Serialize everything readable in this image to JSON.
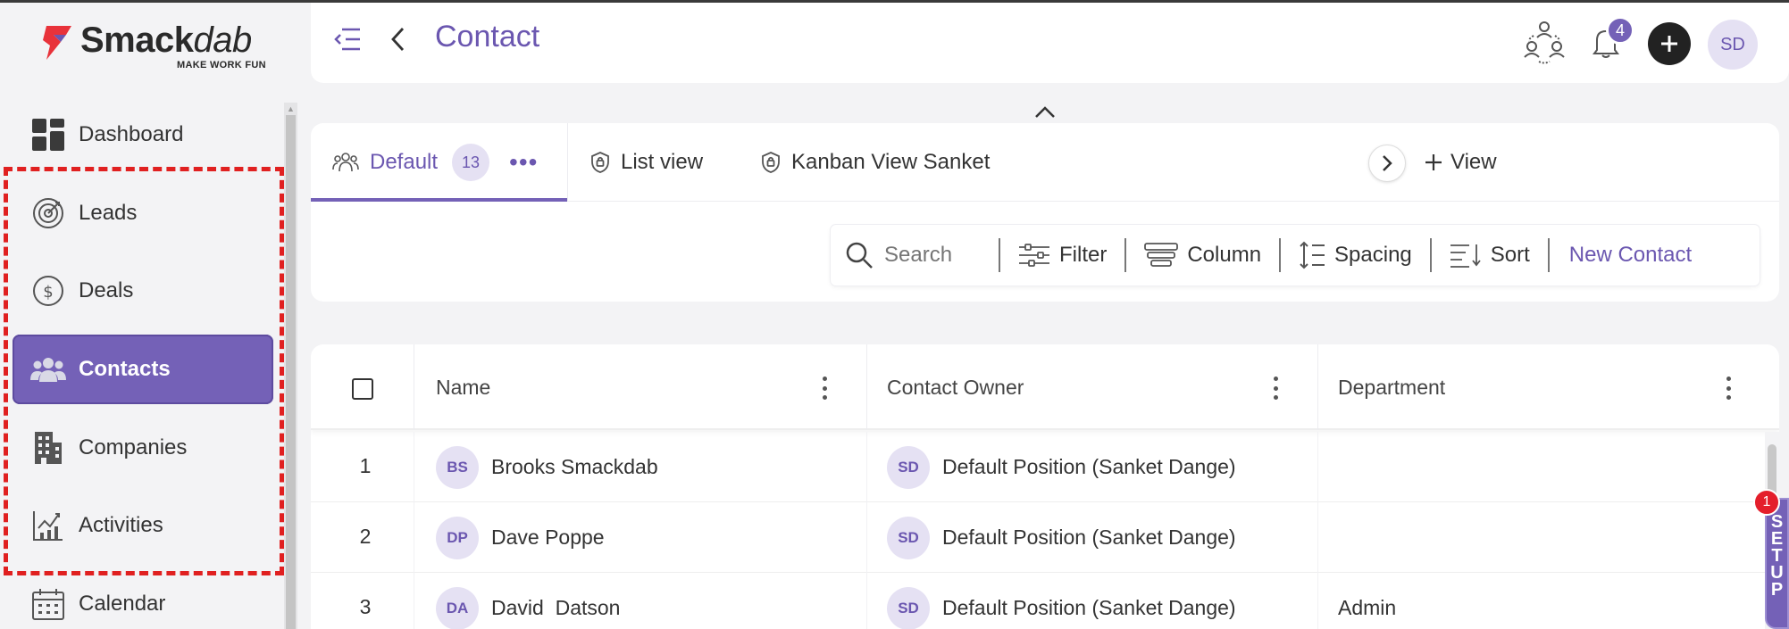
{
  "app": {
    "logo_name_bold": "Smack",
    "logo_name_italic": "dab",
    "logo_tagline": "MAKE WORK FUN",
    "brand_color": "#7461b7",
    "logo_mark_color": "#e8323a"
  },
  "sidebar": {
    "items": [
      {
        "label": "Dashboard",
        "icon": "dashboard-grid-icon",
        "active": false
      },
      {
        "label": "Leads",
        "icon": "target-icon",
        "active": false
      },
      {
        "label": "Deals",
        "icon": "dollar-coin-icon",
        "active": false
      },
      {
        "label": "Contacts",
        "icon": "people-group-icon",
        "active": true
      },
      {
        "label": "Companies",
        "icon": "building-icon",
        "active": false
      },
      {
        "label": "Activities",
        "icon": "activity-chart-icon",
        "active": false
      },
      {
        "label": "Calendar",
        "icon": "calendar-icon",
        "active": false
      }
    ],
    "highlight_color": "#e02020"
  },
  "header": {
    "title": "Contact",
    "notification_count": "4",
    "user_initials": "SD"
  },
  "views": {
    "tabs": [
      {
        "label": "Default",
        "count": "13",
        "active": true,
        "icon": "users-icon"
      },
      {
        "label": "List view",
        "active": false,
        "icon": "shield-lock-icon"
      },
      {
        "label": "Kanban View Sanket",
        "active": false,
        "icon": "shield-lock-icon"
      }
    ],
    "add_view_label": "View"
  },
  "toolbar": {
    "search_placeholder": "Search",
    "filter_label": "Filter",
    "column_label": "Column",
    "spacing_label": "Spacing",
    "sort_label": "Sort",
    "new_contact_label": "New Contact"
  },
  "table": {
    "columns": [
      "Name",
      "Contact Owner",
      "Department"
    ],
    "rows": [
      {
        "num": "1",
        "initials": "BS",
        "name": "Brooks Smackdab",
        "owner_initials": "SD",
        "owner": "Default Position (Sanket Dange)",
        "department": ""
      },
      {
        "num": "2",
        "initials": "DP",
        "name": "Dave Poppe",
        "owner_initials": "SD",
        "owner": "Default Position (Sanket Dange)",
        "department": ""
      },
      {
        "num": "3",
        "initials": "DA",
        "name": "David  Datson",
        "owner_initials": "SD",
        "owner": "Default Position (Sanket Dange)",
        "department": "Admin"
      }
    ]
  },
  "setup": {
    "letters": [
      "S",
      "E",
      "T",
      "U",
      "P"
    ],
    "badge_count": "1"
  }
}
